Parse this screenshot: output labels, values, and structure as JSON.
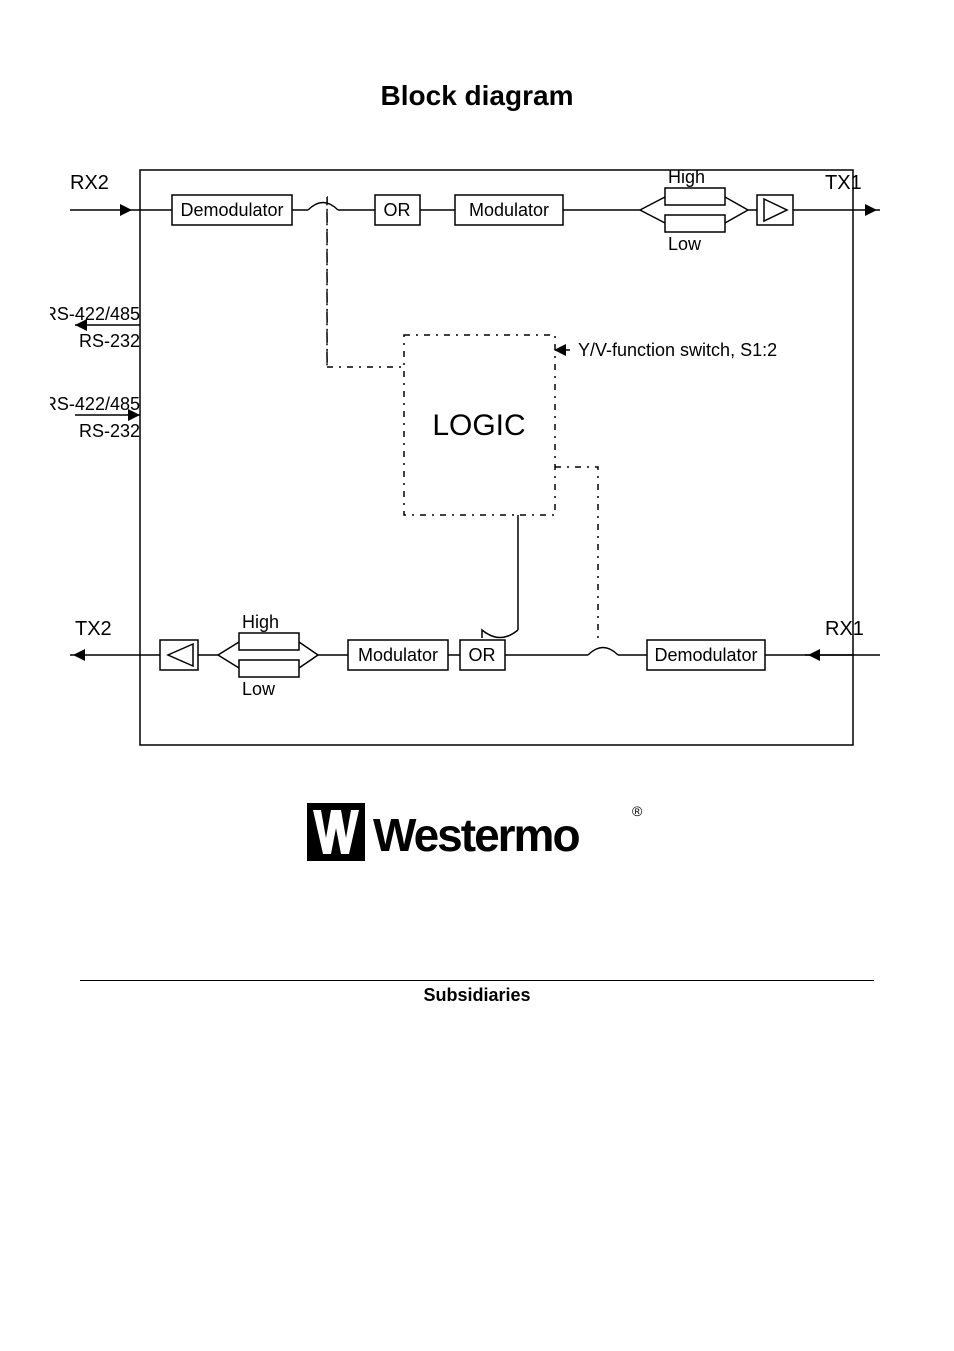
{
  "title": "Block diagram",
  "subsidiaries": "Subsidiaries",
  "brand": "Westermo",
  "brand_trademark": "®",
  "blocks": {
    "demod_top": "Demodulator",
    "or_top": "OR",
    "mod_top": "Modulator",
    "high_top": "High",
    "low_top": "Low",
    "logic": "LOGIC",
    "mod_bot": "Modulator",
    "or_bot": "OR",
    "demod_bot": "Demodulator",
    "high_bot": "High",
    "low_bot": "Low"
  },
  "io": {
    "rx2": "RX2",
    "tx1": "TX1",
    "tx2": "TX2",
    "rx1": "RX1",
    "rs422_in": "RS-422/485",
    "rs232_in": "RS-232",
    "rs422_out": "RS-422/485",
    "rs232_out": "RS-232"
  },
  "switch_label": "Y/V-function switch, S1:2"
}
